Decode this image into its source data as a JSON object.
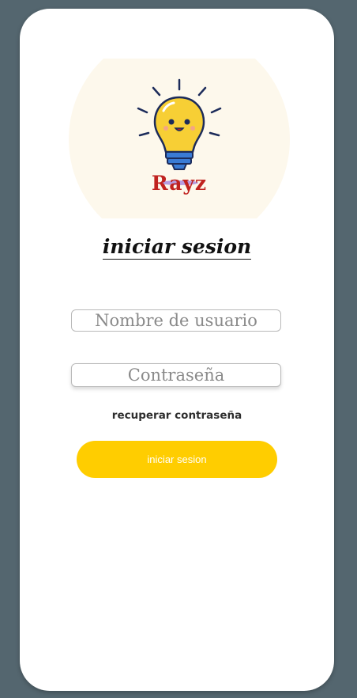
{
  "logo": {
    "brand_text": "Rayz",
    "icon": "lightbulb-icon"
  },
  "title": "iniciar sesion",
  "form": {
    "username_placeholder": "Nombre de usuario",
    "password_placeholder": "Contraseña",
    "recover_label": "recuperar contraseña",
    "submit_label": "iniciar sesion"
  },
  "colors": {
    "page_bg": "#54666f",
    "card_bg": "#ffffff",
    "button": "#ffcd00",
    "brand": "#c0221f"
  }
}
